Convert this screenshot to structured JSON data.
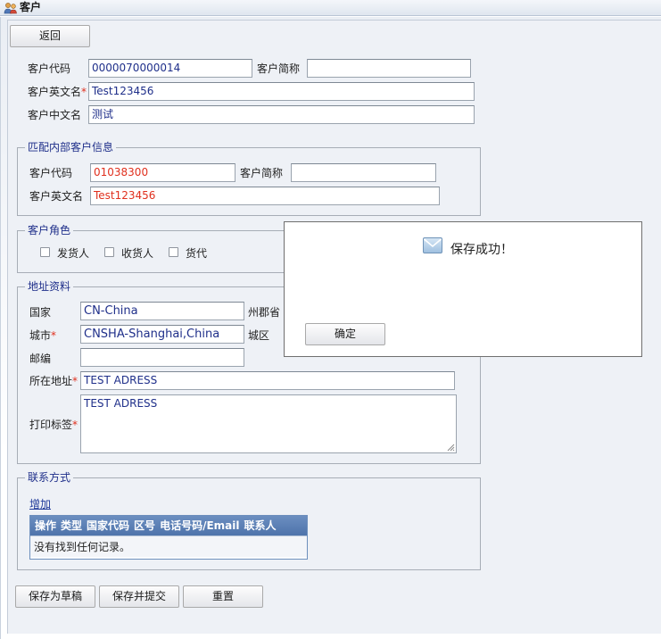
{
  "window": {
    "title": "客户"
  },
  "toolbar": {
    "back_label": "返回"
  },
  "customer": {
    "code_label": "客户代码",
    "code_value": "0000070000014",
    "short_name_label": "客户简称",
    "short_name_value": "",
    "en_name_label": "客户英文名",
    "en_name_value": "Test123456",
    "cn_name_label": "客户中文名",
    "cn_name_value": "测试"
  },
  "internal_match": {
    "legend": "匹配内部客户信息",
    "code_label": "客户代码",
    "code_value": "01038300",
    "short_name_label": "客户简称",
    "short_name_value": "",
    "en_name_label": "客户英文名",
    "en_name_value": "Test123456"
  },
  "roles": {
    "legend": "客户角色",
    "items": [
      {
        "label": "发货人",
        "checked": false
      },
      {
        "label": "收货人",
        "checked": false
      },
      {
        "label": "货代",
        "checked": false
      }
    ]
  },
  "address": {
    "legend": "地址资料",
    "country_label": "国家",
    "country_value": "CN-China",
    "state_label": "州郡省",
    "city_label": "城市",
    "city_value": "CNSHA-Shanghai,China",
    "district_label": "城区",
    "zip_label": "邮编",
    "zip_value": "",
    "addr_label": "所在地址",
    "addr_value": "TEST ADRESS",
    "print_label": "打印标签",
    "print_value": "TEST ADRESS"
  },
  "contact": {
    "legend": "联系方式",
    "add_link": "增加",
    "columns": [
      "操作",
      "类型",
      "国家代码",
      "区号",
      "电话号码/Email",
      "联系人"
    ],
    "empty_text": "没有找到任何记录。"
  },
  "footer": {
    "save_draft_label": "保存为草稿",
    "save_submit_label": "保存并提交",
    "reset_label": "重置"
  },
  "dialog": {
    "message": "保存成功！",
    "ok_label": "确定"
  },
  "colors": {
    "accent": "#1f2f8a",
    "required": "#e0301e",
    "grid_header": "#5a7db5"
  },
  "icons": {
    "title": "users-icon",
    "dialog": "mail-icon"
  }
}
